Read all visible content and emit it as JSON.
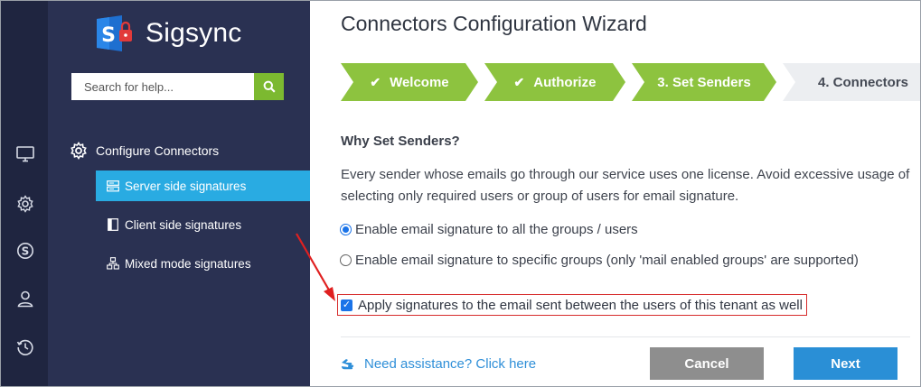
{
  "brand": {
    "name": "Sigsync",
    "accent": "#7cb930"
  },
  "search": {
    "placeholder": "Search for help..."
  },
  "rail": {
    "icons": [
      "monitor-icon",
      "gear-icon",
      "skype-icon",
      "user-icon",
      "history-icon"
    ]
  },
  "sidebar": {
    "section_label": "Configure Connectors",
    "items": [
      {
        "label": "Server side signatures",
        "active": true
      },
      {
        "label": "Client side signatures",
        "active": false
      },
      {
        "label": "Mixed mode signatures",
        "active": false
      }
    ]
  },
  "main": {
    "title": "Connectors Configuration Wizard",
    "steps": [
      {
        "label": "Welcome",
        "state": "done",
        "check": true
      },
      {
        "label": "Authorize",
        "state": "done",
        "check": true
      },
      {
        "label": "3. Set Senders",
        "state": "current",
        "check": false
      },
      {
        "label": "4. Connectors",
        "state": "todo",
        "check": false
      }
    ],
    "heading": "Why Set Senders?",
    "description_line1": "Every sender whose emails go through our service uses one license. Avoid excessive usage of",
    "description_line2": "selecting only required users or group of users for email signature.",
    "option_all": "Enable email signature to all the groups / users",
    "option_specific": "Enable email signature to specific groups (only 'mail enabled groups' are supported)",
    "selected_option": "all",
    "apply_label": "Apply signatures to the email sent between the users of this tenant as well",
    "apply_checked": true,
    "assist_label": "Need assistance? Click here",
    "cancel_label": "Cancel",
    "next_label": "Next"
  },
  "colors": {
    "rail": "#1f2540",
    "sidebar": "#2a3152",
    "active_item": "#29abe2",
    "step_done": "#8dc33f",
    "step_todo": "#eceef1",
    "primary": "#2a8fd6",
    "highlight": "#d62b2b"
  }
}
